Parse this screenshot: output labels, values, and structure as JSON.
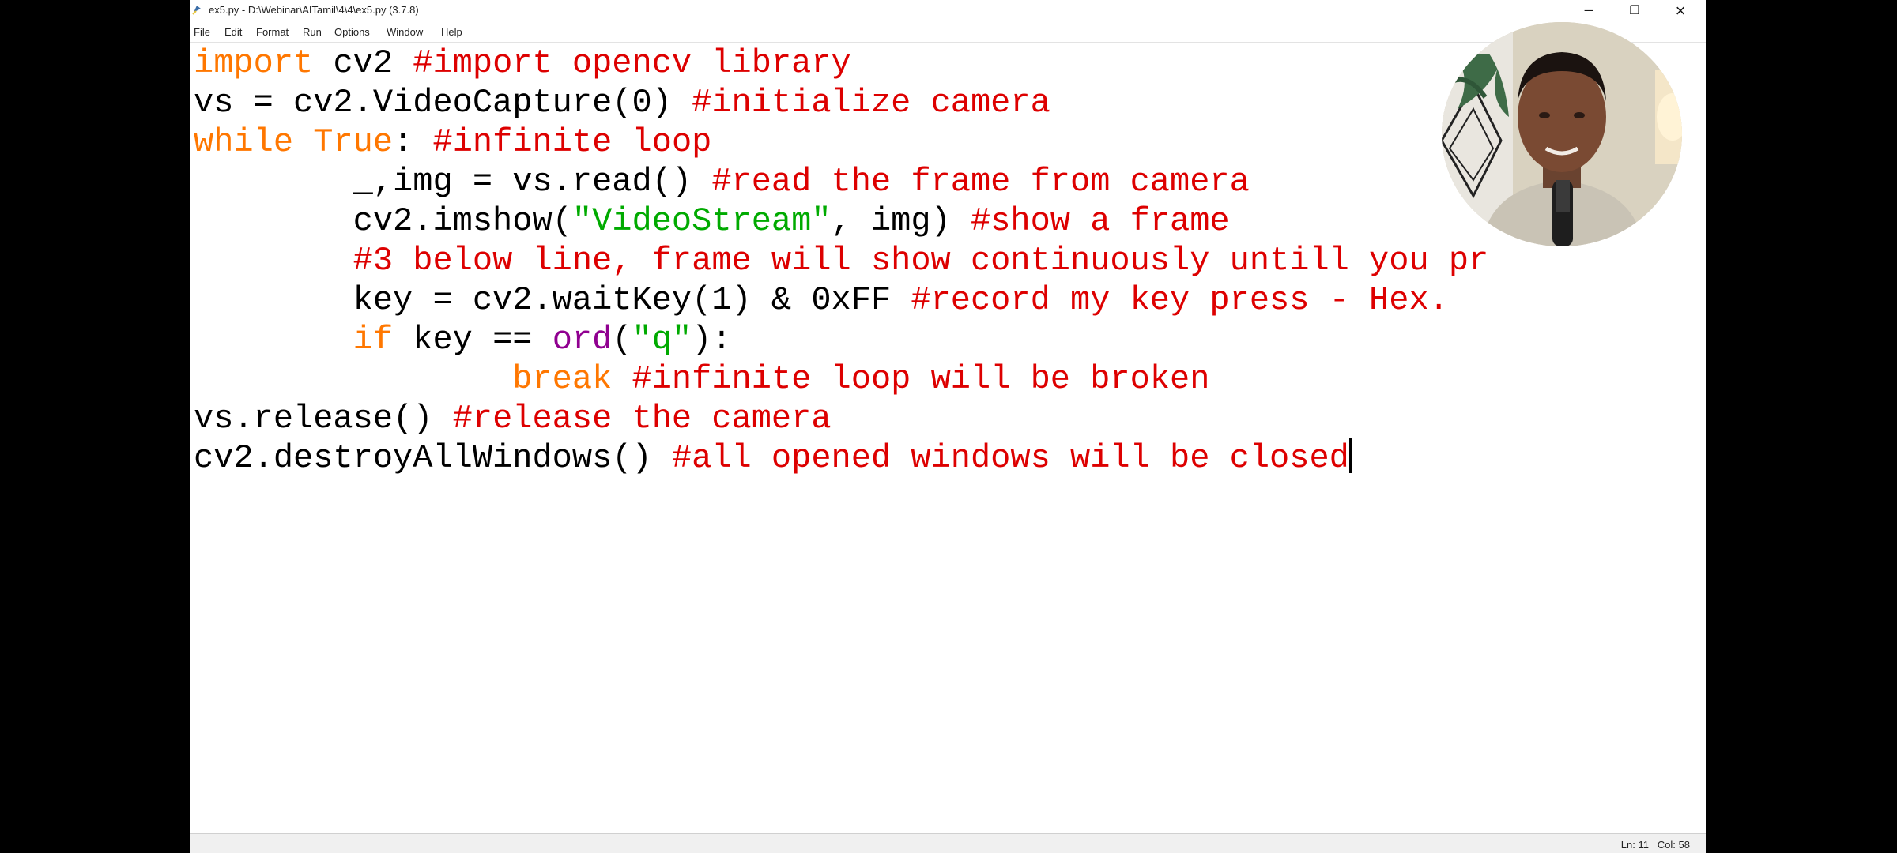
{
  "window": {
    "title": "ex5.py - D:\\Webinar\\AITamil\\4\\4\\ex5.py (3.7.8)",
    "controls": {
      "minimize": "─",
      "maximize": "❐",
      "close": "×"
    }
  },
  "menu": [
    "File",
    "Edit",
    "Format",
    "Run",
    "Options",
    "Window",
    "Help"
  ],
  "code": {
    "l1": {
      "kw": "import",
      "plain": " cv2 ",
      "comment": "#import opencv library"
    },
    "l2": {
      "plain": "vs = cv2.VideoCapture(0) ",
      "comment": "#initialize camera"
    },
    "l3": {
      "kw1": "while",
      "sp": " ",
      "kw2": "True",
      "colon": ": ",
      "comment": "#infinite loop"
    },
    "l4": {
      "plain": "        _,img = vs.read() ",
      "comment": "#read the frame from camera"
    },
    "l5": {
      "plain1": "        cv2.imshow(",
      "str": "\"VideoStream\"",
      "plain2": ", img) ",
      "comment": "#show a frame"
    },
    "l6": {
      "plain": "        ",
      "comment": "#3 below line, frame will show continuously untill you pr"
    },
    "l7": {
      "plain": "        key = cv2.waitKey(1) & 0xFF ",
      "comment": "#record my key press - Hex."
    },
    "l8": {
      "indent": "        ",
      "kw": "if",
      "plain1": " key == ",
      "builtin": "ord",
      "paren": "(",
      "str": "\"q\"",
      "plain2": "):"
    },
    "l9": {
      "indent": "                ",
      "kw": "break",
      "sp": " ",
      "comment": "#infinite loop will be broken"
    },
    "l10": {
      "plain": "vs.release() ",
      "comment": "#release the camera"
    },
    "l11": {
      "plain": "cv2.destroyAllWindows() ",
      "comment": "#all opened windows will be closed"
    }
  },
  "status": {
    "position": "Ln: 11   Col: 58"
  },
  "colors": {
    "keyword": "#ff7700",
    "comment": "#dd0000",
    "string": "#00aa00",
    "builtin": "#900090"
  }
}
